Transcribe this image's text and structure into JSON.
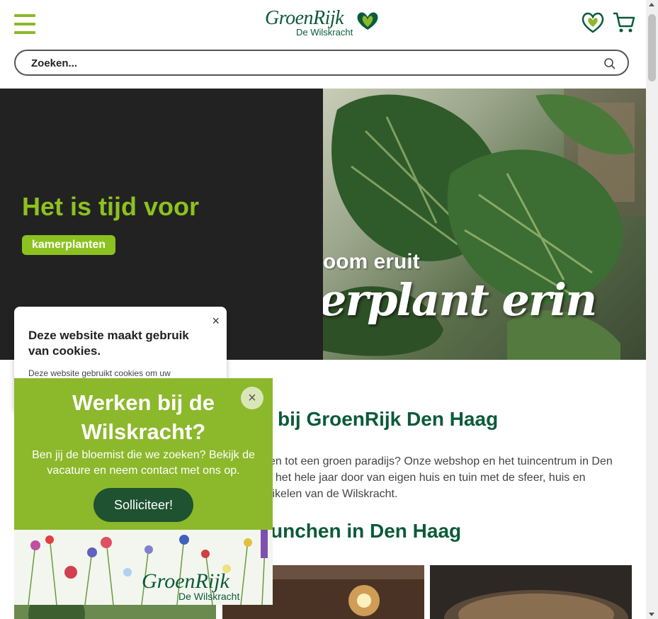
{
  "header": {
    "logo_word": "GroenRijk",
    "logo_sub": "De Wilskracht",
    "search_placeholder": "Zoeken..."
  },
  "hero": {
    "title": "Het is tijd voor",
    "tag": "kamerplanten",
    "image_text_line1": "oom eruit",
    "image_text_line2": "erplant erin"
  },
  "main": {
    "heading1": "bij GroenRijk Den Haag",
    "intro_lines": [
      "en tot een groen paradijs? Onze webshop en het tuincentrum in Den",
      "t het hele jaar door van eigen huis en tuin met de sfeer, huis en",
      "tikelen van de Wilskracht."
    ],
    "heading2": "unchen in Den Haag"
  },
  "cookie": {
    "title": "Deze website maakt gebruik van cookies.",
    "body": "Deze website gebruikt cookies om uw",
    "close": "×"
  },
  "job_popup": {
    "title": "Werken bij de Wilskracht?",
    "description": "Ben jij de bloemist die we zoeken? Bekijk de vacature en neem contact met ons op.",
    "button": "Solliciteer!",
    "close": "×",
    "logo_word": "GroenRijk",
    "logo_sub": "De Wilskracht"
  },
  "colors": {
    "brand_green": "#8cb82b",
    "hero_green": "#8cc21f",
    "dark_green": "#0b5a3a",
    "button_dark": "#1e5230"
  }
}
